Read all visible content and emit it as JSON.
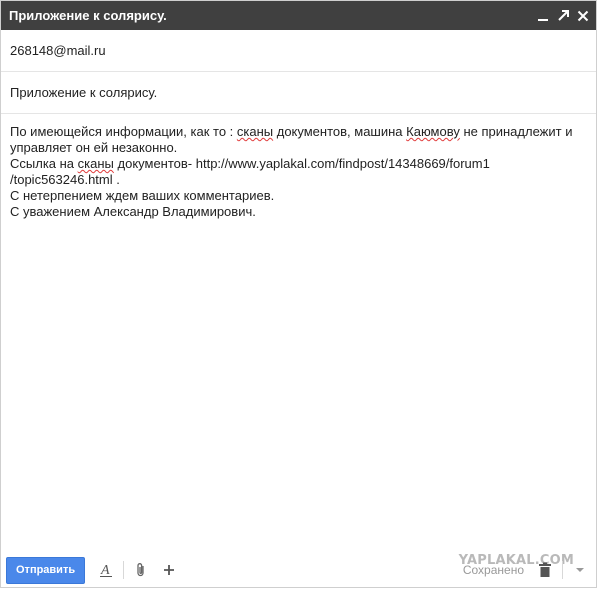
{
  "window": {
    "title": "Приложение к солярису."
  },
  "compose": {
    "to": "268148@mail.ru",
    "subject": "Приложение к солярису.",
    "body": {
      "line1_a": "По имеющейся информации, как то : ",
      "line1_b": "сканы",
      "line1_c": " документов, машина ",
      "line1_d": "Каюмову",
      "line1_e": " не принадлежит и",
      "line2": "управляет он ей незаконно.",
      "line3_a": "Ссылка на ",
      "line3_b": "сканы",
      "line3_c": " документов- http://www.yaplakal.com/findpost/14348669/forum1",
      "line4": "/topic563246.html .",
      "line5": "С нетерпением ждем ваших комментариев.",
      "line6": "С уважением Александр Владимирович."
    }
  },
  "toolbar": {
    "send_label": "Отправить",
    "saved_label": "Сохранено"
  },
  "watermark": "YAPLAKAL.COM",
  "icons": {
    "minimize": "minimize-icon",
    "popout": "popout-icon",
    "close": "close-icon",
    "format": "text-format-icon",
    "attach": "paperclip-icon",
    "more": "plus-icon",
    "trash": "trash-icon",
    "options": "dropdown-arrow-icon"
  },
  "colors": {
    "titlebar": "#404040",
    "send_button": "#4a88ea"
  }
}
